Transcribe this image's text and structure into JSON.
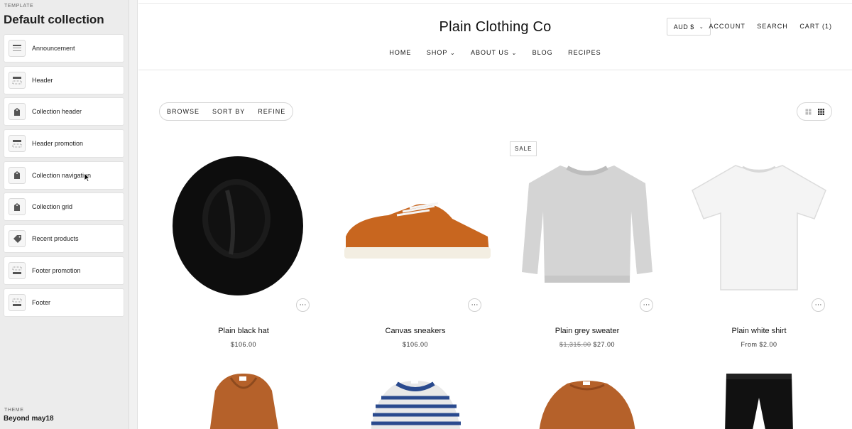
{
  "sidebar": {
    "template_label": "TEMPLATE",
    "title": "Default collection",
    "items": [
      {
        "label": "Announcement",
        "icon": "announcement-section-icon"
      },
      {
        "label": "Header",
        "icon": "header-section-icon"
      },
      {
        "label": "Collection header",
        "icon": "collection-icon"
      },
      {
        "label": "Header promotion",
        "icon": "header-section-icon"
      },
      {
        "label": "Collection navigation",
        "icon": "collection-icon"
      },
      {
        "label": "Collection grid",
        "icon": "collection-icon"
      },
      {
        "label": "Recent products",
        "icon": "tag-icon"
      },
      {
        "label": "Footer promotion",
        "icon": "footer-section-icon"
      },
      {
        "label": "Footer",
        "icon": "footer-section-icon"
      }
    ],
    "theme_label": "THEME",
    "theme_name": "Beyond may18"
  },
  "store": {
    "brand": "Plain Clothing Co",
    "currency": "AUD $",
    "links": {
      "account": "ACCOUNT",
      "search": "SEARCH",
      "cart": "CART (1)"
    },
    "nav": {
      "home": "HOME",
      "shop": "SHOP",
      "about": "ABOUT US",
      "blog": "BLOG",
      "recipes": "RECIPES"
    },
    "filters": {
      "browse": "BROWSE",
      "sort": "SORT BY",
      "refine": "REFINE"
    },
    "sale_badge": "SALE",
    "products": [
      {
        "name": "Plain black hat",
        "price": "$106.00"
      },
      {
        "name": "Canvas sneakers",
        "price": "$106.00"
      },
      {
        "name": "Plain grey sweater",
        "compare_price": "$1,315.00",
        "price": "$27.00"
      },
      {
        "name": "Plain white shirt",
        "price": "From $2.00"
      }
    ],
    "colors": {
      "hat": "#0d0d0d",
      "sneaker": "#c8661f",
      "sweater": "#d4d4d4",
      "shirt": "#f4f4f4",
      "hoodie": "#b5612a",
      "stripe": "#2a4a8e"
    }
  }
}
